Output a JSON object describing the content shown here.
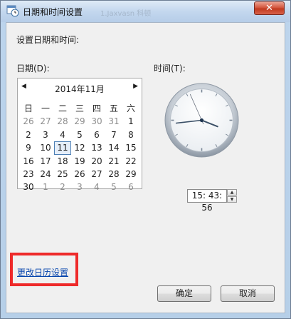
{
  "window": {
    "title": "日期和时间设置",
    "title_ghost": "1.Jaxvasn 科顿",
    "close_glyph": "✕"
  },
  "heading": "设置日期和时间:",
  "date_label": "日期(D):",
  "time_label": "时间(T):",
  "calendar": {
    "prev_glyph": "◀",
    "next_glyph": "▶",
    "month": "2014年11月",
    "weekdays": [
      "日",
      "一",
      "二",
      "三",
      "四",
      "五",
      "六"
    ],
    "weeks": [
      [
        {
          "d": "26",
          "o": true
        },
        {
          "d": "27",
          "o": true
        },
        {
          "d": "28",
          "o": true
        },
        {
          "d": "29",
          "o": true
        },
        {
          "d": "30",
          "o": true
        },
        {
          "d": "31",
          "o": true
        },
        {
          "d": "1"
        }
      ],
      [
        {
          "d": "2"
        },
        {
          "d": "3"
        },
        {
          "d": "4"
        },
        {
          "d": "5"
        },
        {
          "d": "6"
        },
        {
          "d": "7"
        },
        {
          "d": "8"
        }
      ],
      [
        {
          "d": "9"
        },
        {
          "d": "10"
        },
        {
          "d": "11",
          "s": true
        },
        {
          "d": "12"
        },
        {
          "d": "13"
        },
        {
          "d": "14"
        },
        {
          "d": "15"
        }
      ],
      [
        {
          "d": "16"
        },
        {
          "d": "17"
        },
        {
          "d": "18"
        },
        {
          "d": "19"
        },
        {
          "d": "20"
        },
        {
          "d": "21"
        },
        {
          "d": "22"
        }
      ],
      [
        {
          "d": "23"
        },
        {
          "d": "24"
        },
        {
          "d": "25"
        },
        {
          "d": "26"
        },
        {
          "d": "27"
        },
        {
          "d": "28"
        },
        {
          "d": "29"
        }
      ],
      [
        {
          "d": "30"
        },
        {
          "d": "1",
          "o": true
        },
        {
          "d": "2",
          "o": true
        },
        {
          "d": "3",
          "o": true
        },
        {
          "d": "4",
          "o": true
        },
        {
          "d": "5",
          "o": true
        },
        {
          "d": "6",
          "o": true
        }
      ]
    ]
  },
  "clock": {
    "hour": 15,
    "minute": 43,
    "second": 56
  },
  "time_value": "15: 43: 56",
  "change_calendar_link": "更改日历设置",
  "buttons": {
    "ok": "确定",
    "cancel": "取消"
  },
  "colors": {
    "highlight": "#ee2a2a",
    "link": "#0645ad",
    "selected_border": "#4d7fb5"
  }
}
